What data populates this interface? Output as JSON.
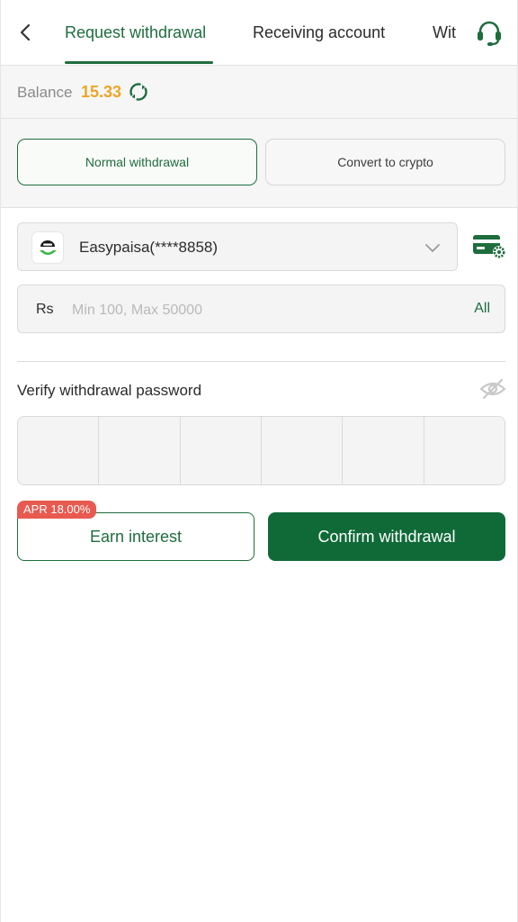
{
  "header": {
    "tabs": [
      {
        "label": "Request withdrawal",
        "active": true
      },
      {
        "label": "Receiving account",
        "active": false
      },
      {
        "label": "Wit",
        "active": false
      }
    ],
    "icons": {
      "back": "chevron-left-icon",
      "support": "headset-icon"
    }
  },
  "balance": {
    "label": "Balance",
    "value": "15.33",
    "icon": "refresh-icon"
  },
  "modes": {
    "normal_label": "Normal withdrawal",
    "crypto_label": "Convert to crypto",
    "selected": "Normal withdrawal"
  },
  "account": {
    "name": "Easypaisa(****8858)",
    "icon": "easypaisa-logo",
    "settings_icon": "card-settings-icon"
  },
  "amount": {
    "currency": "Rs",
    "placeholder": "Min 100, Max 50000",
    "value": "",
    "all_label": "All"
  },
  "password": {
    "label": "Verify withdrawal password",
    "digits": [
      "",
      "",
      "",
      "",
      "",
      ""
    ],
    "visibility_icon": "eye-off-icon"
  },
  "actions": {
    "apr_badge": "APR 18.00%",
    "earn_label": "Earn interest",
    "confirm_label": "Confirm withdrawal"
  },
  "colors": {
    "accent": "#1f6d3e",
    "balance": "#f0a425",
    "badge": "#e85a4f",
    "primary_button": "#0f6a38"
  }
}
